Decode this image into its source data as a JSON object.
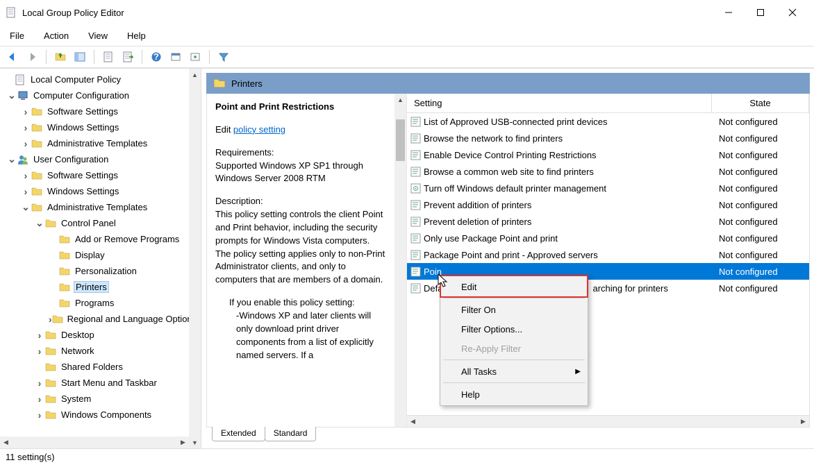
{
  "window": {
    "title": "Local Group Policy Editor"
  },
  "menubar": [
    "File",
    "Action",
    "View",
    "Help"
  ],
  "tree": {
    "root": "Local Computer Policy",
    "items": [
      {
        "depth": 0,
        "tw": "",
        "icon": "doc",
        "label": "Local Computer Policy"
      },
      {
        "depth": 0,
        "tw": "v",
        "icon": "computer",
        "label": "Computer Configuration"
      },
      {
        "depth": 1,
        "tw": ">",
        "icon": "folder",
        "label": "Software Settings"
      },
      {
        "depth": 1,
        "tw": ">",
        "icon": "folder",
        "label": "Windows Settings"
      },
      {
        "depth": 1,
        "tw": ">",
        "icon": "folder",
        "label": "Administrative Templates"
      },
      {
        "depth": 0,
        "tw": "v",
        "icon": "user",
        "label": "User Configuration"
      },
      {
        "depth": 1,
        "tw": ">",
        "icon": "folder",
        "label": "Software Settings"
      },
      {
        "depth": 1,
        "tw": ">",
        "icon": "folder",
        "label": "Windows Settings"
      },
      {
        "depth": 1,
        "tw": "v",
        "icon": "folder",
        "label": "Administrative Templates"
      },
      {
        "depth": 2,
        "tw": "v",
        "icon": "folder",
        "label": "Control Panel"
      },
      {
        "depth": 3,
        "tw": "",
        "icon": "folder",
        "label": "Add or Remove Programs"
      },
      {
        "depth": 3,
        "tw": "",
        "icon": "folder",
        "label": "Display"
      },
      {
        "depth": 3,
        "tw": "",
        "icon": "folder",
        "label": "Personalization"
      },
      {
        "depth": 3,
        "tw": "",
        "icon": "folder",
        "label": "Printers",
        "selected": true
      },
      {
        "depth": 3,
        "tw": "",
        "icon": "folder",
        "label": "Programs"
      },
      {
        "depth": 3,
        "tw": ">",
        "icon": "folder",
        "label": "Regional and Language Options"
      },
      {
        "depth": 2,
        "tw": ">",
        "icon": "folder",
        "label": "Desktop"
      },
      {
        "depth": 2,
        "tw": ">",
        "icon": "folder",
        "label": "Network"
      },
      {
        "depth": 2,
        "tw": "",
        "icon": "folder",
        "label": "Shared Folders"
      },
      {
        "depth": 2,
        "tw": ">",
        "icon": "folder",
        "label": "Start Menu and Taskbar"
      },
      {
        "depth": 2,
        "tw": ">",
        "icon": "folder",
        "label": "System"
      },
      {
        "depth": 2,
        "tw": ">",
        "icon": "folder",
        "label": "Windows Components"
      }
    ]
  },
  "panel": {
    "title": "Printers",
    "desc_title": "Point and Print Restrictions",
    "edit_prefix": "Edit",
    "edit_link": "policy setting",
    "requirements_label": "Requirements:",
    "requirements_text": "Supported Windows XP SP1 through Windows Server 2008 RTM",
    "description_label": "Description:",
    "description_text": "This policy setting controls the client Point and Print behavior, including the security prompts for Windows Vista computers. The policy setting applies only to non-Print Administrator clients, and only to computers that are members of a domain.",
    "description_text2": "If you enable this policy setting:",
    "description_text3": "-Windows XP and later clients will only download print driver components from a list of explicitly named servers. If a"
  },
  "list": {
    "col_setting": "Setting",
    "col_state": "State",
    "rows": [
      {
        "label": "List of Approved USB-connected print devices",
        "state": "Not configured"
      },
      {
        "label": "Browse the network to find printers",
        "state": "Not configured"
      },
      {
        "label": "Enable Device Control Printing Restrictions",
        "state": "Not configured"
      },
      {
        "label": "Browse a common web site to find printers",
        "state": "Not configured"
      },
      {
        "label": "Turn off Windows default printer management",
        "state": "Not configured",
        "icon": "gear"
      },
      {
        "label": "Prevent addition of printers",
        "state": "Not configured"
      },
      {
        "label": "Prevent deletion of printers",
        "state": "Not configured"
      },
      {
        "label": "Only use Package Point and print",
        "state": "Not configured"
      },
      {
        "label": "Package Point and print - Approved servers",
        "state": "Not configured"
      },
      {
        "label": "Point and Print Restrictions",
        "state": "Not configured",
        "selected": true,
        "truncated": "Poin"
      },
      {
        "label": "Default Active Directory path when searching for printers",
        "state": "Not configured",
        "truncated_mid": true
      }
    ]
  },
  "tabs": {
    "extended": "Extended",
    "standard": "Standard"
  },
  "context_menu": {
    "items": [
      {
        "label": "Edit",
        "highlight": true
      },
      {
        "sep": true
      },
      {
        "label": "Filter On"
      },
      {
        "label": "Filter Options..."
      },
      {
        "label": "Re-Apply Filter",
        "disabled": true
      },
      {
        "sep": true
      },
      {
        "label": "All Tasks",
        "submenu": true
      },
      {
        "sep": true
      },
      {
        "label": "Help"
      }
    ]
  },
  "statusbar": {
    "text": "11 setting(s)"
  }
}
